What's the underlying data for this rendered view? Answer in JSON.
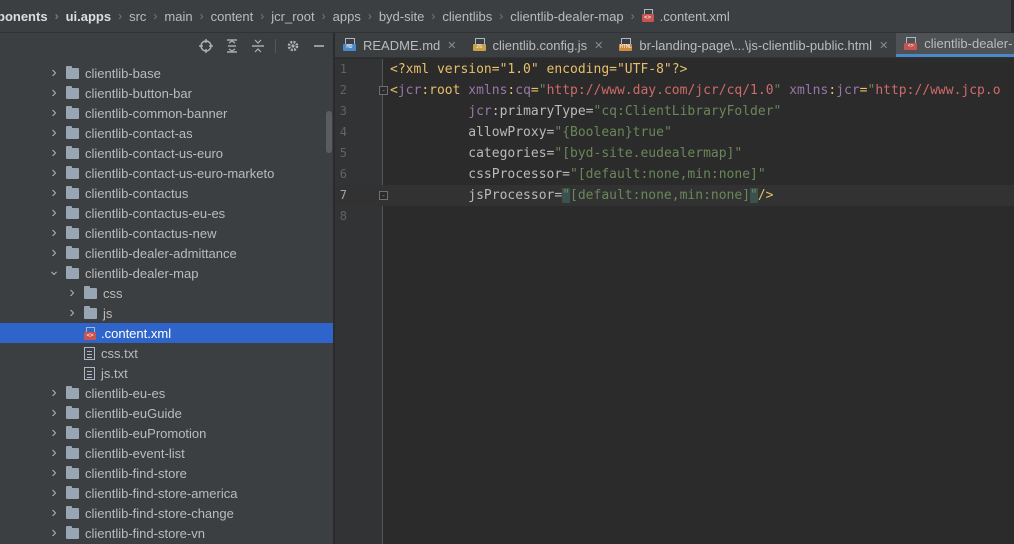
{
  "breadcrumb": [
    {
      "label": "ponents",
      "bold": true
    },
    {
      "label": "ui.apps",
      "bold": true
    },
    {
      "label": "src",
      "bold": false
    },
    {
      "label": "main",
      "bold": false
    },
    {
      "label": "content",
      "bold": false
    },
    {
      "label": "jcr_root",
      "bold": false
    },
    {
      "label": "apps",
      "bold": false
    },
    {
      "label": "byd-site",
      "bold": false
    },
    {
      "label": "clientlibs",
      "bold": false
    },
    {
      "label": "clientlib-dealer-map",
      "bold": false
    },
    {
      "label": ".content.xml",
      "bold": false,
      "icon": "xml-file-icon"
    }
  ],
  "toolbar_icons": [
    "crosshair-icon",
    "expand-all-icon",
    "collapse-all-icon",
    "gear-icon",
    "minimize-icon"
  ],
  "tree": [
    {
      "label": "clientlib-base",
      "type": "folder",
      "depth": 0,
      "expanded": false
    },
    {
      "label": "clientlib-button-bar",
      "type": "folder",
      "depth": 0,
      "expanded": false
    },
    {
      "label": "clientlib-common-banner",
      "type": "folder",
      "depth": 0,
      "expanded": false
    },
    {
      "label": "clientlib-contact-as",
      "type": "folder",
      "depth": 0,
      "expanded": false
    },
    {
      "label": "clientlib-contact-us-euro",
      "type": "folder",
      "depth": 0,
      "expanded": false
    },
    {
      "label": "clientlib-contact-us-euro-marketo",
      "type": "folder",
      "depth": 0,
      "expanded": false
    },
    {
      "label": "clientlib-contactus",
      "type": "folder",
      "depth": 0,
      "expanded": false
    },
    {
      "label": "clientlib-contactus-eu-es",
      "type": "folder",
      "depth": 0,
      "expanded": false
    },
    {
      "label": "clientlib-contactus-new",
      "type": "folder",
      "depth": 0,
      "expanded": false
    },
    {
      "label": "clientlib-dealer-admittance",
      "type": "folder",
      "depth": 0,
      "expanded": false
    },
    {
      "label": "clientlib-dealer-map",
      "type": "folder",
      "depth": 0,
      "expanded": true
    },
    {
      "label": "css",
      "type": "folder",
      "depth": 1,
      "expanded": false
    },
    {
      "label": "js",
      "type": "folder",
      "depth": 1,
      "expanded": false
    },
    {
      "label": ".content.xml",
      "type": "xml",
      "depth": 1,
      "selected": true
    },
    {
      "label": "css.txt",
      "type": "txt",
      "depth": 1
    },
    {
      "label": "js.txt",
      "type": "txt",
      "depth": 1
    },
    {
      "label": "clientlib-eu-es",
      "type": "folder",
      "depth": 0,
      "expanded": false
    },
    {
      "label": "clientlib-euGuide",
      "type": "folder",
      "depth": 0,
      "expanded": false
    },
    {
      "label": "clientlib-euPromotion",
      "type": "folder",
      "depth": 0,
      "expanded": false
    },
    {
      "label": "clientlib-event-list",
      "type": "folder",
      "depth": 0,
      "expanded": false
    },
    {
      "label": "clientlib-find-store",
      "type": "folder",
      "depth": 0,
      "expanded": false
    },
    {
      "label": "clientlib-find-store-america",
      "type": "folder",
      "depth": 0,
      "expanded": false
    },
    {
      "label": "clientlib-find-store-change",
      "type": "folder",
      "depth": 0,
      "expanded": false
    },
    {
      "label": "clientlib-find-store-vn",
      "type": "folder",
      "depth": 0,
      "expanded": false
    }
  ],
  "tabs": [
    {
      "label": "README.md",
      "badge": "MD",
      "badge_color": "#4a88c7",
      "active": false
    },
    {
      "label": "clientlib.config.js",
      "badge": "JS",
      "badge_color": "#c9a14a",
      "active": false
    },
    {
      "label": "br-landing-page\\...\\js-clientlib-public.html",
      "badge": "HTML",
      "badge_color": "#d08b3f",
      "active": false
    },
    {
      "label": "clientlib-dealer-",
      "badge": "<>",
      "badge_color": "#c75450",
      "active": true
    }
  ],
  "editor": {
    "current_line": 7,
    "lines": [
      {
        "n": "1",
        "tokens": [
          [
            "c-dec",
            "<?xml version=\"1.0\" encoding=\"UTF-8\"?>"
          ]
        ]
      },
      {
        "n": "2",
        "fold": "-",
        "tokens": [
          [
            "c-tag",
            "<"
          ],
          [
            "c-ns",
            "jcr"
          ],
          [
            "c-tag",
            ":root "
          ],
          [
            "c-ns",
            "xmlns"
          ],
          [
            "c-tag",
            ":"
          ],
          [
            "c-ns",
            "cq"
          ],
          [
            "c-tag",
            "="
          ],
          [
            "c-val",
            "\""
          ],
          [
            "c-urlv",
            "http://www.day.com/jcr/cq/1.0"
          ],
          [
            "c-val",
            "\""
          ],
          [
            "c-tag",
            " "
          ],
          [
            "c-ns",
            "xmlns"
          ],
          [
            "c-tag",
            ":"
          ],
          [
            "c-ns",
            "jcr"
          ],
          [
            "c-tag",
            "="
          ],
          [
            "c-val",
            "\""
          ],
          [
            "c-urlv",
            "http://www.jcp.o"
          ]
        ]
      },
      {
        "n": "3",
        "tokens": [
          [
            "c-attr",
            "          "
          ],
          [
            "c-ns",
            "jcr"
          ],
          [
            "c-attr",
            ":primaryType="
          ],
          [
            "c-val",
            "\"cq:ClientLibraryFolder\""
          ]
        ]
      },
      {
        "n": "4",
        "tokens": [
          [
            "c-attr",
            "          allowProxy="
          ],
          [
            "c-val",
            "\"{Boolean}true\""
          ]
        ]
      },
      {
        "n": "5",
        "tokens": [
          [
            "c-attr",
            "          categories="
          ],
          [
            "c-val",
            "\"[byd-site.eudealermap]\""
          ]
        ]
      },
      {
        "n": "6",
        "tokens": [
          [
            "c-attr",
            "          cssProcessor="
          ],
          [
            "c-val",
            "\"[default:none,min:none]\""
          ]
        ]
      },
      {
        "n": "7",
        "fold": "-",
        "tokens": [
          [
            "c-attr",
            "          jsProcessor="
          ],
          [
            "c-brk",
            "\""
          ],
          [
            "c-val",
            "[default:none,min:none]"
          ],
          [
            "c-brk",
            "\""
          ],
          [
            "c-tag",
            "/>"
          ]
        ]
      },
      {
        "n": "8",
        "tokens": []
      }
    ]
  },
  "colors": {
    "selection": "#2f65ca",
    "editor_bg": "#2b2b2b",
    "panel_bg": "#3c3f41"
  }
}
